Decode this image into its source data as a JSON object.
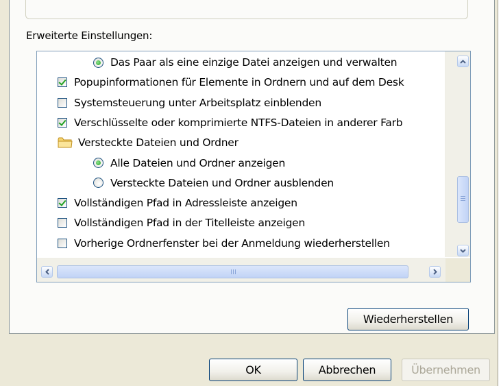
{
  "section": {
    "label": "Erweiterte Einstellungen:"
  },
  "items": [
    {
      "type": "radio",
      "indent": 2,
      "state": true,
      "label": "Das Paar als eine einzige Datei anzeigen und verwalten"
    },
    {
      "type": "checkbox",
      "indent": 1,
      "state": true,
      "label": "Popupinformationen für Elemente in Ordnern und auf dem Desk"
    },
    {
      "type": "checkbox",
      "indent": 1,
      "state": false,
      "label": "Systemsteuerung unter Arbeitsplatz einblenden"
    },
    {
      "type": "checkbox",
      "indent": 1,
      "state": true,
      "label": "Verschlüsselte oder komprimierte NTFS-Dateien in anderer Farb"
    },
    {
      "type": "folder",
      "indent": 1,
      "label": "Versteckte Dateien und Ordner"
    },
    {
      "type": "radio",
      "indent": 2,
      "state": true,
      "label": "Alle Dateien und Ordner anzeigen"
    },
    {
      "type": "radio",
      "indent": 2,
      "state": false,
      "label": "Versteckte Dateien und Ordner ausblenden"
    },
    {
      "type": "checkbox",
      "indent": 1,
      "state": true,
      "label": "Vollständigen Pfad in Adressleiste anzeigen"
    },
    {
      "type": "checkbox",
      "indent": 1,
      "state": false,
      "label": "Vollständigen Pfad in der Titelleiste anzeigen"
    },
    {
      "type": "checkbox",
      "indent": 1,
      "state": false,
      "label": "Vorherige Ordnerfenster bei der Anmeldung wiederherstellen"
    }
  ],
  "buttons": {
    "restore": "Wiederherstellen",
    "ok": "OK",
    "cancel": "Abbrechen",
    "apply": "Übernehmen"
  },
  "colors": {
    "check": "#21a121",
    "dialog_bg": "#ece9d8",
    "border_blue": "#003c74"
  }
}
